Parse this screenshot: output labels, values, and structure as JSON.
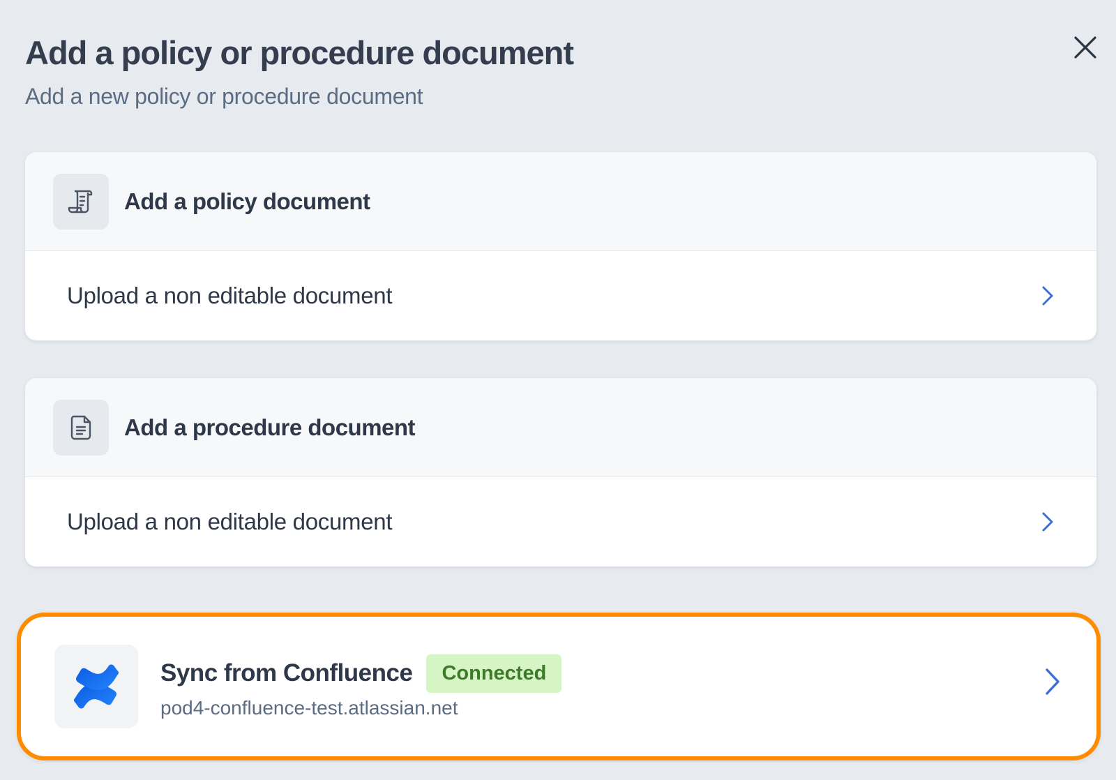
{
  "header": {
    "title": "Add a policy or procedure document",
    "subtitle": "Add a new policy or procedure document"
  },
  "cards": [
    {
      "title": "Add a policy document",
      "icon": "scroll-document-icon",
      "row_label": "Upload a non editable document"
    },
    {
      "title": "Add a procedure document",
      "icon": "document-lines-icon",
      "row_label": "Upload a non editable document"
    }
  ],
  "sync": {
    "title": "Sync from Confluence",
    "badge": "Connected",
    "url": "pod4-confluence-test.atlassian.net",
    "icon": "confluence-logo-icon"
  },
  "colors": {
    "accent": "#3b6fd6",
    "highlight": "#ff8c00",
    "badge_bg": "#d6f5c4",
    "badge_text": "#3f7a2a"
  }
}
